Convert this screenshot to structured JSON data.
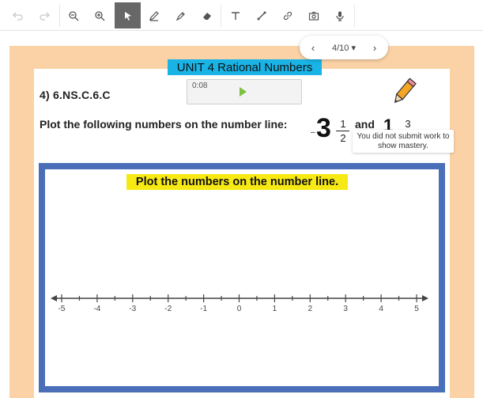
{
  "toolbar": {
    "tools": [
      {
        "name": "undo",
        "icon": "undo-icon",
        "enabled": false
      },
      {
        "name": "redo",
        "icon": "redo-icon",
        "enabled": false
      },
      {
        "name": "zoom-out",
        "icon": "zoom-out-icon",
        "enabled": true
      },
      {
        "name": "zoom-in",
        "icon": "zoom-in-icon",
        "enabled": true
      },
      {
        "name": "select",
        "icon": "cursor-icon",
        "enabled": true,
        "active": true
      },
      {
        "name": "pen",
        "icon": "pen-icon",
        "enabled": true
      },
      {
        "name": "highlighter",
        "icon": "highlighter-icon",
        "enabled": true
      },
      {
        "name": "eraser",
        "icon": "eraser-icon",
        "enabled": true
      },
      {
        "name": "text",
        "icon": "text-icon",
        "enabled": true
      },
      {
        "name": "line",
        "icon": "line-icon",
        "enabled": true
      },
      {
        "name": "link",
        "icon": "link-icon",
        "enabled": true
      },
      {
        "name": "camera",
        "icon": "camera-icon",
        "enabled": true
      },
      {
        "name": "microphone",
        "icon": "microphone-icon",
        "enabled": true
      }
    ]
  },
  "pager": {
    "label": "4/10 ▾",
    "prev_icon": "chevron-left-icon",
    "next_icon": "chevron-right-icon"
  },
  "worksheet": {
    "unit_title": "UNIT 4 Rational Numbers",
    "standard": "4)  6.NS.C.6.C",
    "audio": {
      "time": "0:08"
    },
    "prompt": "Plot the following numbers on the number line:",
    "number1": {
      "sign": "–",
      "whole": "3",
      "numerator": "1",
      "denominator": "2"
    },
    "and_word": "and",
    "number2": {
      "whole": "1",
      "numerator": "3"
    },
    "tooltip": "You did not submit work to show mastery.",
    "frame_title": "Plot the numbers on the number line.",
    "number_line": {
      "ticks": [
        "-5",
        "-4",
        "-3",
        "-2",
        "-1",
        "0",
        "1",
        "2",
        "3",
        "4",
        "5"
      ]
    }
  },
  "colors": {
    "accent_blue": "#19b3e6",
    "frame_blue": "#4a6fb8",
    "highlight_yellow": "#f7ea14",
    "sheet_bg": "#fbd2a6"
  }
}
